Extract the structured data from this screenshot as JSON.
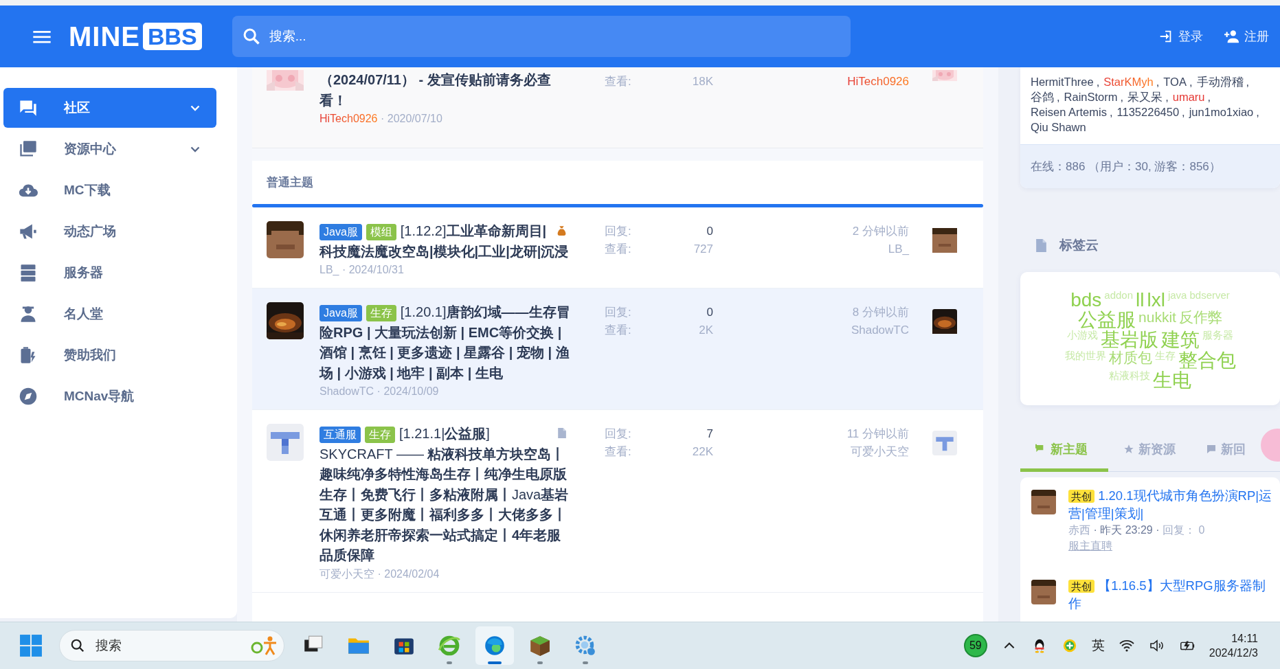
{
  "header": {
    "logo_main": "MINE",
    "logo_box": "BBS",
    "search": {
      "placeholder": "搜索..."
    },
    "actions": [
      {
        "label": "登录"
      },
      {
        "label": "注册"
      }
    ]
  },
  "sidebar": {
    "items": [
      {
        "label": "社区",
        "selected": true,
        "expandable": true
      },
      {
        "label": "资源中心",
        "selected": false,
        "expandable": true
      },
      {
        "label": "MC下载",
        "selected": false,
        "expandable": false
      },
      {
        "label": "动态广场",
        "selected": false,
        "expandable": false
      },
      {
        "label": "服务器",
        "selected": false,
        "expandable": false
      },
      {
        "label": "名人堂",
        "selected": false,
        "expandable": false
      },
      {
        "label": "赞助我们",
        "selected": false,
        "expandable": false
      },
      {
        "label": "MCNav导航",
        "selected": false,
        "expandable": false
      }
    ]
  },
  "sticky_thread": {
    "title": "（2024/07/11） - 发宣传贴前请务必查看！",
    "author": "HiTech0926",
    "date": "· 2020/07/10",
    "views_label": "查看:",
    "views": "18K",
    "last_user": "HiTech0926"
  },
  "section": {
    "title": "普通主题"
  },
  "threads": [
    {
      "prefixes": [
        {
          "label": "Java服",
          "color": "#2f7de1"
        },
        {
          "label": "模组",
          "color": "#8bc34a"
        }
      ],
      "title": "[1.12.2]**工业革命新周目|科技魔法魔改空岛|模块化|工业|龙研|沉浸**",
      "author": "LB_",
      "date": "· 2024/10/31",
      "replies_label": "回复:",
      "replies": "0",
      "views_label": "查看:",
      "views": "727",
      "last_time": "2 分钟以前",
      "last_user": "LB_",
      "highlighted": false
    },
    {
      "prefixes": [
        {
          "label": "Java服",
          "color": "#2f7de1"
        },
        {
          "label": "生存",
          "color": "#8bc34a"
        }
      ],
      "title": "[1.20.1]**唐韵幻域——生存冒险RPG | 大量玩法创新 | EMC等价交换 | 酒馆 | 烹饪 | 更多遗迹 | 星露谷 | 宠物 | 渔场 | 小游戏 | 地牢 | 副本 | 生电**",
      "author": "ShadowTC",
      "date": "· 2024/10/09",
      "replies_label": "回复:",
      "replies": "0",
      "views_label": "查看:",
      "views": "2K",
      "last_time": "8 分钟以前",
      "last_user": "ShadowTC",
      "highlighted": true
    },
    {
      "prefixes": [
        {
          "label": "互通服",
          "color": "#2f7de1"
        },
        {
          "label": "生存",
          "color": "#8bc34a"
        }
      ],
      "title": "[1.21.1|**公益服**] SKYCRAFT —— **粘液科技单方块空岛丨趣味纯净多特性海岛生存丨纯净生电原版生存丨免费飞行丨多粘液附属丨**Java**基岩互通丨更多附魔丨福利多多丨大佬多多丨休闲养老肝帝探索一站式搞定丨4年老服品质保障**",
      "author": "可爱小天空",
      "date": "· 2024/02/04",
      "replies_label": "回复:",
      "replies": "7",
      "views_label": "查看:",
      "views": "22K",
      "last_time": "11 分钟以前",
      "last_user": "可爱小天空",
      "highlighted": false
    }
  ],
  "online": {
    "users": [
      {
        "name": "HermitThree",
        "kind": "plain",
        "sep": ","
      },
      {
        "name": "StarKMyh",
        "kind": "vip",
        "sep": ","
      },
      {
        "name": "TOA",
        "kind": "plain",
        "sep": ","
      },
      {
        "name": "手动滑稽",
        "kind": "plain",
        "sep": ","
      },
      {
        "name": "谷鸽",
        "kind": "plain",
        "sep": ","
      },
      {
        "name": "RainStorm",
        "kind": "plain",
        "sep": ","
      },
      {
        "name": "呆又呆",
        "kind": "plain",
        "sep": ","
      },
      {
        "name": "umaru",
        "kind": "admin",
        "sep": ","
      },
      {
        "name": "Reisen Artemis",
        "kind": "plain",
        "sep": ","
      },
      {
        "name": "1135226450",
        "kind": "plain",
        "sep": ","
      },
      {
        "name": "jun1mo1xiao",
        "kind": "plain",
        "sep": ","
      },
      {
        "name": "Qiu Shawn",
        "kind": "plain"
      }
    ],
    "summary": "在线：886 （用户：30, 游客：856）"
  },
  "tag_cloud": {
    "title": "标签云",
    "tags": [
      {
        "text": "bds",
        "kind": "large"
      },
      {
        "text": "addon",
        "kind": "small"
      },
      {
        "text": "ll",
        "kind": "large"
      },
      {
        "text": "lxl",
        "kind": "large"
      },
      {
        "text": "java",
        "kind": "small"
      },
      {
        "text": "bdserver",
        "kind": "small"
      },
      {
        "text": "公益服",
        "kind": "large"
      },
      {
        "text": "nukkit",
        "kind": "medium"
      },
      {
        "text": "反作弊",
        "kind": "medium"
      },
      {
        "text": "小游戏",
        "kind": "small"
      },
      {
        "text": "基岩版",
        "kind": "large"
      },
      {
        "text": "建筑",
        "kind": "large"
      },
      {
        "text": "服务器",
        "kind": "small"
      },
      {
        "text": "我的世界",
        "kind": "small"
      },
      {
        "text": "材质包",
        "kind": "medium"
      },
      {
        "text": "生存",
        "kind": "small"
      },
      {
        "text": "整合包",
        "kind": "large"
      },
      {
        "text": "粘液科技",
        "kind": "small"
      },
      {
        "text": "生电",
        "kind": "large"
      }
    ]
  },
  "feed_tabs": [
    {
      "label": "新主题",
      "selected": true
    },
    {
      "label": "新资源",
      "selected": false
    },
    {
      "label": "新回",
      "selected": false
    }
  ],
  "new_threads": [
    {
      "badge": "共创",
      "title": "1.20.1现代城市角色扮演RP|运营|管理|策划|",
      "author": "赤西",
      "time": "· 昨天 23:29 ·",
      "replies": "回复： 0",
      "forum": "服主直聘"
    },
    {
      "badge": "共创",
      "title": "【1.16.5】大型RPG服务器制作"
    }
  ],
  "taskbar": {
    "search_placeholder": "搜索",
    "apps": [
      {
        "running": false,
        "active": false
      },
      {
        "running": false,
        "active": false
      },
      {
        "running": false,
        "active": false
      },
      {
        "running": true,
        "active": false
      },
      {
        "running": true,
        "active": true
      },
      {
        "running": true,
        "active": false
      },
      {
        "running": true,
        "active": false
      }
    ],
    "tray_badge": "59",
    "ime": "英",
    "time": "14:11",
    "date": "2024/12/3"
  }
}
